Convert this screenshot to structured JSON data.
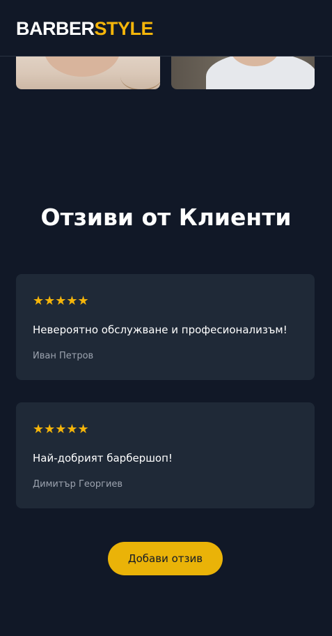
{
  "header": {
    "logo_part1": "BARBER",
    "logo_part2": "STYLE"
  },
  "colors": {
    "background": "#111827",
    "card": "#1f2937",
    "accent": "#eab308",
    "muted_text": "#9ca3af"
  },
  "gallery": {
    "images": [
      {
        "name": "barber-photo-left"
      },
      {
        "name": "barber-photo-right"
      }
    ]
  },
  "testimonials": {
    "title": "Отзиви от Клиенти",
    "items": [
      {
        "stars": "★★★★★",
        "rating": 5,
        "text": "Невероятно обслужване и професионализъм!",
        "author": "Иван Петров"
      },
      {
        "stars": "★★★★★",
        "rating": 5,
        "text": "Най-добрият барбершоп!",
        "author": "Димитър Георгиев"
      }
    ],
    "add_button_label": "Добави отзив"
  }
}
